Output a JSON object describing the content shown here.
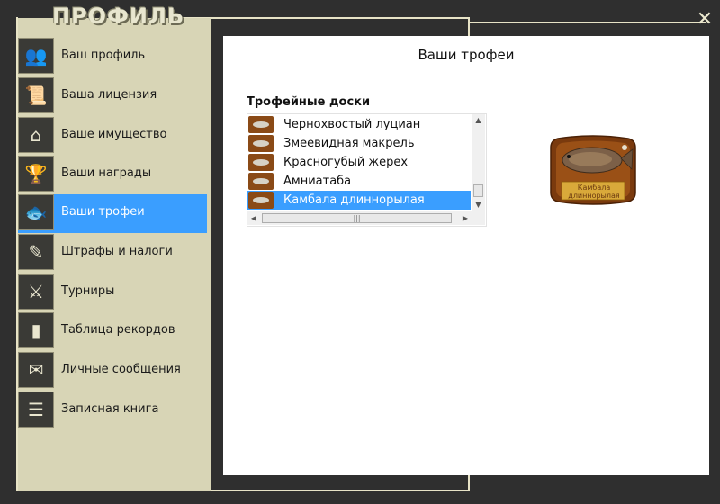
{
  "window": {
    "title": "ПРОФИЛЬ",
    "close_glyph": "✕"
  },
  "sidebar": {
    "items": [
      {
        "label": "Ваш профиль",
        "icon": "users-icon",
        "active": false
      },
      {
        "label": "Ваша лицензия",
        "icon": "license-icon",
        "active": false
      },
      {
        "label": "Ваше имущество",
        "icon": "house-icon",
        "active": false
      },
      {
        "label": "Ваши награды",
        "icon": "trophy-cup-icon",
        "active": false
      },
      {
        "label": "Ваши трофеи",
        "icon": "fish-icon",
        "active": true
      },
      {
        "label": "Штрафы и налоги",
        "icon": "document-pen-icon",
        "active": false
      },
      {
        "label": "Турниры",
        "icon": "crossed-swords-icon",
        "active": false
      },
      {
        "label": "Таблица рекордов",
        "icon": "bar-chart-icon",
        "active": false
      },
      {
        "label": "Личные сообщения",
        "icon": "envelope-icon",
        "active": false
      },
      {
        "label": "Записная книга",
        "icon": "notebook-icon",
        "active": false
      }
    ]
  },
  "main": {
    "title": "Ваши трофеи",
    "boards_title": "Трофейные доски",
    "boards": [
      {
        "name": "Чернохвостый луциан",
        "selected": false
      },
      {
        "name": "Змеевидная макрель",
        "selected": false
      },
      {
        "name": "Красногубый жерех",
        "selected": false
      },
      {
        "name": "Амниатаба",
        "selected": false
      },
      {
        "name": "Камбала длиннорылая",
        "selected": true
      }
    ],
    "hscroll_grip": "|||",
    "preview": {
      "label": "Камбала длиннорылая"
    }
  },
  "colors": {
    "accent": "#3a9eff",
    "frame": "#2f2f2f",
    "sidebar": "#d8d5b6",
    "border_line": "#e7e3c6"
  }
}
